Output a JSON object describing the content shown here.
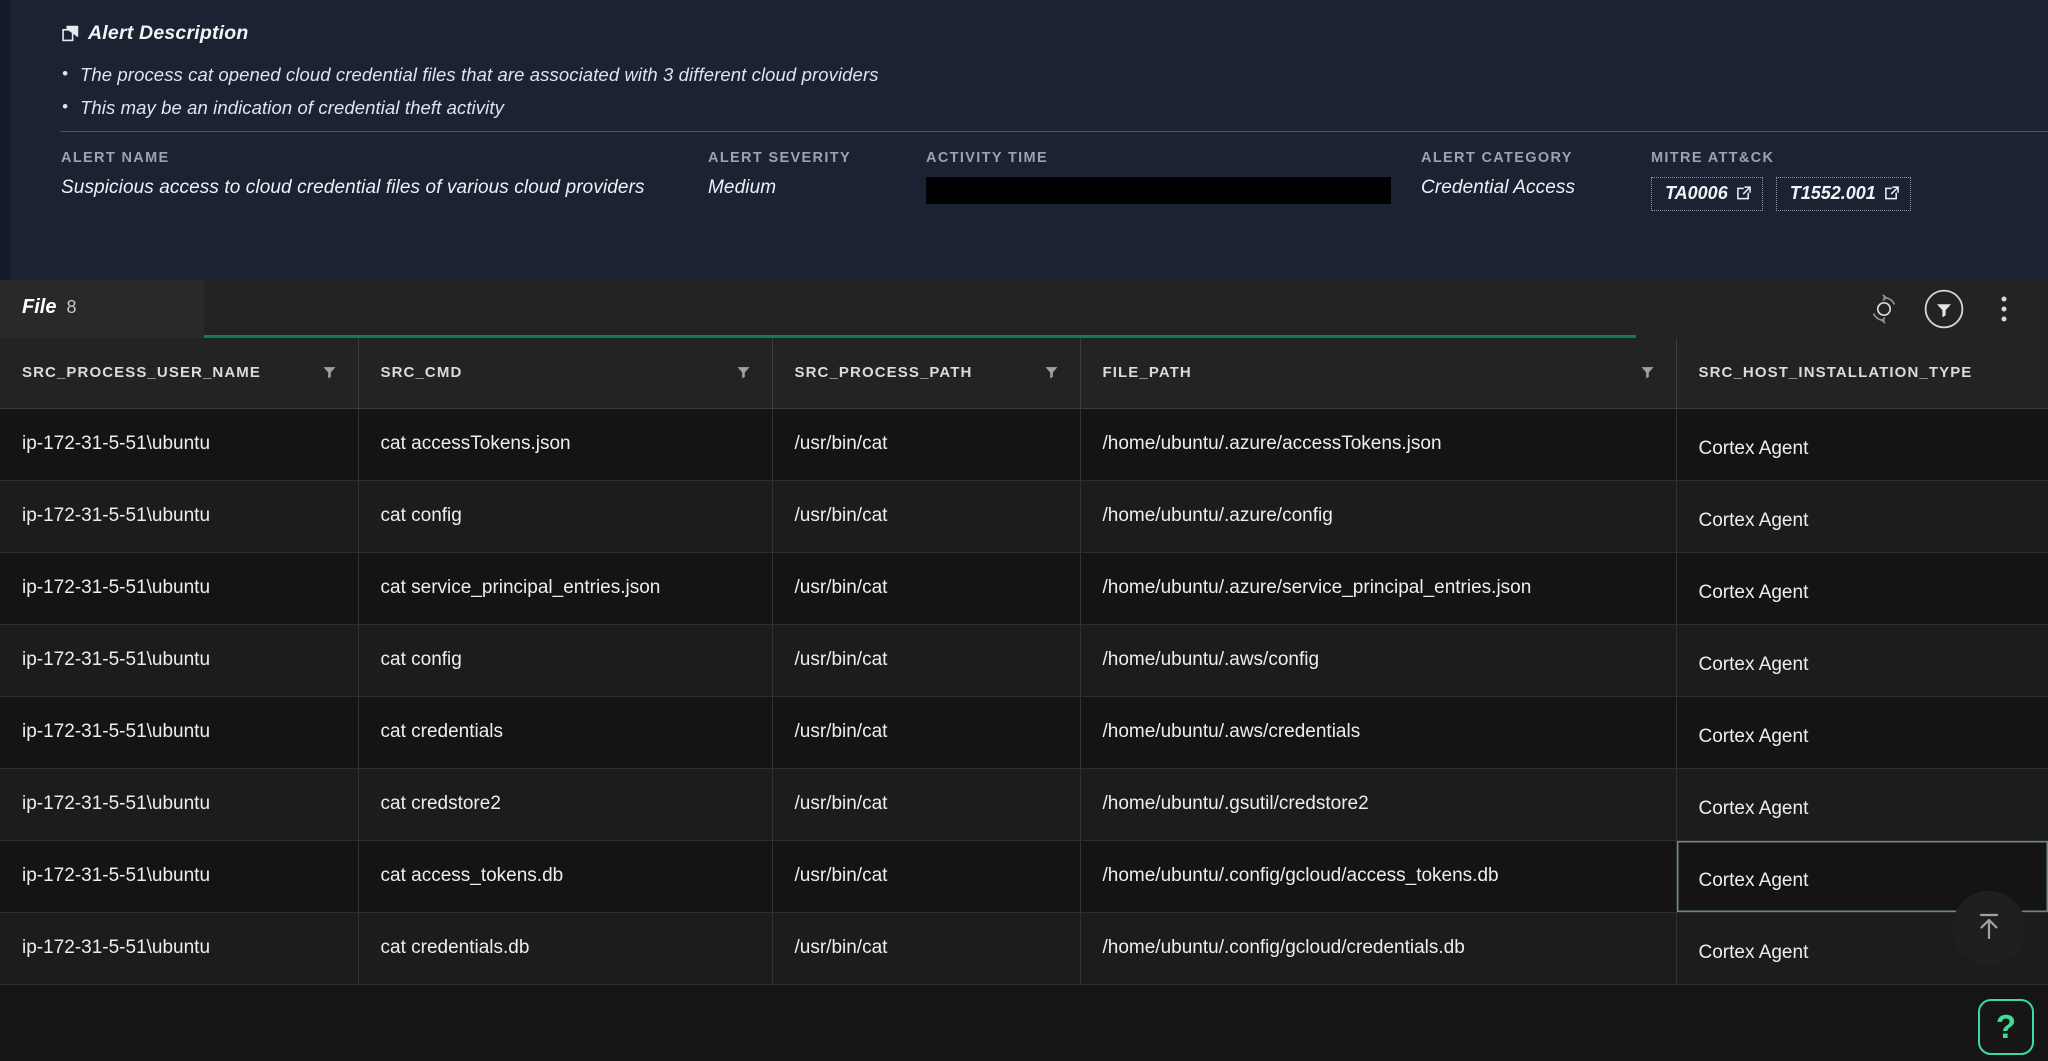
{
  "alert": {
    "description_heading": "Alert Description",
    "description_icon": "copy-icon",
    "description_bullets": [
      "The process cat opened cloud credential files that are associated with 3 different cloud providers",
      "This may be an indication of credential theft activity"
    ],
    "fields": {
      "name_label": "ALERT NAME",
      "name_value": "Suspicious access to cloud credential files of various cloud providers",
      "severity_label": "ALERT SEVERITY",
      "severity_value": "Medium",
      "activity_time_label": "ACTIVITY TIME",
      "activity_time_value": "",
      "category_label": "ALERT CATEGORY",
      "category_value": "Credential Access",
      "mitre_label": "MITRE ATT&CK"
    },
    "mitre_tags": [
      {
        "id": "TA0006",
        "icon": "external-link-icon"
      },
      {
        "id": "T1552.001",
        "icon": "external-link-icon"
      }
    ]
  },
  "tabs": [
    {
      "label": "File",
      "count": "8",
      "active": true
    }
  ],
  "toolbar": {
    "reset_icon": "reset-circle-icon",
    "filter_icon": "filter-funnel-icon",
    "more_icon": "more-vertical-icon"
  },
  "table": {
    "columns": [
      {
        "key": "user",
        "label": "SRC_PROCESS_USER_NAME",
        "filterable": true,
        "class": "c1"
      },
      {
        "key": "cmd",
        "label": "SRC_CMD",
        "filterable": true,
        "class": "c2"
      },
      {
        "key": "path",
        "label": "SRC_PROCESS_PATH",
        "filterable": true,
        "class": "c3"
      },
      {
        "key": "file",
        "label": "FILE_PATH",
        "filterable": true,
        "class": "c4"
      },
      {
        "key": "install",
        "label": "SRC_HOST_INSTALLATION_TYPE",
        "filterable": false,
        "class": "c5"
      }
    ],
    "rows": [
      {
        "user": "ip-172-31-5-51\\ubuntu",
        "cmd": "cat accessTokens.json",
        "path": "/usr/bin/cat",
        "file": "/home/ubuntu/.azure/accessTokens.json",
        "install": "Cortex Agent",
        "selected": false
      },
      {
        "user": "ip-172-31-5-51\\ubuntu",
        "cmd": "cat config",
        "path": "/usr/bin/cat",
        "file": "/home/ubuntu/.azure/config",
        "install": "Cortex Agent",
        "selected": false
      },
      {
        "user": "ip-172-31-5-51\\ubuntu",
        "cmd": "cat service_principal_entries.json",
        "path": "/usr/bin/cat",
        "file": "/home/ubuntu/.azure/service_principal_entries.json",
        "install": "Cortex Agent",
        "selected": false
      },
      {
        "user": "ip-172-31-5-51\\ubuntu",
        "cmd": "cat config",
        "path": "/usr/bin/cat",
        "file": "/home/ubuntu/.aws/config",
        "install": "Cortex Agent",
        "selected": false
      },
      {
        "user": "ip-172-31-5-51\\ubuntu",
        "cmd": "cat credentials",
        "path": "/usr/bin/cat",
        "file": "/home/ubuntu/.aws/credentials",
        "install": "Cortex Agent",
        "selected": false
      },
      {
        "user": "ip-172-31-5-51\\ubuntu",
        "cmd": "cat credstore2",
        "path": "/usr/bin/cat",
        "file": "/home/ubuntu/.gsutil/credstore2",
        "install": "Cortex Agent",
        "selected": false
      },
      {
        "user": "ip-172-31-5-51\\ubuntu",
        "cmd": "cat access_tokens.db",
        "path": "/usr/bin/cat",
        "file": "/home/ubuntu/.config/gcloud/access_tokens.db",
        "install": "Cortex Agent",
        "selected": true
      },
      {
        "user": "ip-172-31-5-51\\ubuntu",
        "cmd": "cat credentials.db",
        "path": "/usr/bin/cat",
        "file": "/home/ubuntu/.config/gcloud/credentials.db",
        "install": "Cortex Agent",
        "selected": false
      }
    ]
  },
  "floating": {
    "scroll_top_icon": "arrow-up-to-line-icon",
    "help_label": "?"
  },
  "colors": {
    "panel_bg": "#1b2333",
    "tab_accent": "#22c978",
    "help_accent": "#3ddc9a",
    "table_bg": "#151515"
  }
}
